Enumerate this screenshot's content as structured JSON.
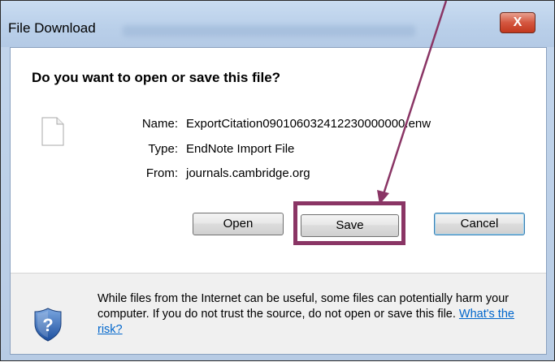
{
  "window": {
    "title": "File Download",
    "close_glyph": "X"
  },
  "dialog": {
    "question": "Do you want to open or save this file?",
    "file": {
      "name_label": "Name:",
      "name_value": "ExportCitation090106032412230000000.enw",
      "type_label": "Type:",
      "type_value": "EndNote Import File",
      "from_label": "From:",
      "from_value": "journals.cambridge.org"
    },
    "buttons": {
      "open": "Open",
      "save": "Save",
      "cancel": "Cancel"
    },
    "warning": {
      "text": "While files from the Internet can be useful, some files can potentially harm your computer. If you do not trust the source, do not open or save this file.",
      "link": "What's the risk?"
    }
  },
  "icons": {
    "file": "blank-file-icon",
    "shield": "security-shield-icon",
    "close": "close-icon"
  },
  "colors": {
    "highlight": "#8a3565",
    "arrow": "#8a3565",
    "link": "#0066cc"
  }
}
